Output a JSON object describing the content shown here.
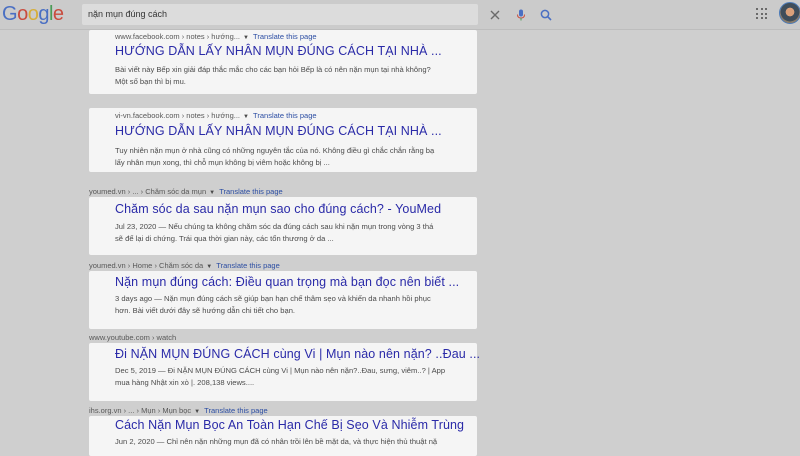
{
  "header": {
    "logo": [
      "G",
      "o",
      "o",
      "g",
      "l",
      "e"
    ],
    "logo_colors": [
      "#4a6fc3",
      "#c94c3e",
      "#d6ae3a",
      "#4a6fc3",
      "#4a9b56",
      "#c94c3e"
    ],
    "search_value": "nặn mụn đúng cách",
    "icons": [
      "close-icon",
      "mic-icon",
      "search-icon",
      "apps-grid-icon",
      "avatar"
    ]
  },
  "results": [
    {
      "source": "www.facebook.com › notes › hướng...",
      "translate": "Translate this page",
      "title": "HƯỚNG DẪN LẤY NHÂN MỤN ĐÚNG CÁCH TẠI NHÀ ...",
      "snippet": [
        "Bài viết này Bếp xin giải đáp thắc mắc cho các bạn hỏi Bếp là có nên nặn mụn tại nhà không?",
        "Một số bạn thì bị mu."
      ]
    },
    {
      "source": "vi-vn.facebook.com › notes › hướng...",
      "translate": "Translate this page",
      "title": "HƯỚNG DẪN LẤY NHÂN MỤN ĐÚNG CÁCH TẠI NHÀ ...",
      "snippet": [
        "Tuy nhiên nặn mụn ở nhà cũng có những nguyên tắc của nó. Không điều gì chắc chắn rằng bạ",
        "lấy nhân mụn xong, thì chỗ mụn không bị viêm hoặc không bị ..."
      ]
    },
    {
      "source": "youmed.vn › ... › Chăm sóc da mụn",
      "translate": "Translate this page",
      "title": "Chăm sóc da sau nặn mụn sao cho đúng cách? - YouMed",
      "snippet": [
        "Jul 23, 2020 — Nếu chúng ta không chăm sóc da đúng cách sau khi nặn mụn trong vòng 3 thá",
        "sẽ để lại di chứng. Trái qua thời gian này, các tổn thương ở da ..."
      ]
    },
    {
      "source": "youmed.vn › Home › Chăm sóc da",
      "translate": "Translate this page",
      "title": "Nặn mụn đúng cách: Điều quan trọng mà bạn đọc nên biết ...",
      "snippet": [
        "3 days ago — Nặn mụn đúng cách sẽ giúp bạn hạn chế thâm sẹo và khiến da nhanh hồi phục",
        "hơn. Bài viết dưới đây sẽ hướng dẫn chi tiết cho bạn."
      ]
    },
    {
      "source": "www.youtube.com › watch",
      "translate": "",
      "title": "Đi NẶN MỤN ĐÚNG CÁCH cùng Vi | Mụn nào nên nặn? ..Đau ...",
      "snippet": [
        "Dec 5, 2019 — Đi NẶN MỤN ĐÚNG CÁCH cùng Vi | Mụn nào nên nặn?..Đau, sưng, viêm..? | App",
        "mua hàng Nhật xin xò |. 208,138 views...."
      ]
    },
    {
      "source": "ihs.org.vn › ... › Mụn › Mụn bọc",
      "translate": "Translate this page",
      "title": "Cách Nặn Mụn Bọc An Toàn Hạn Chế Bị Sẹo Và Nhiễm Trùng",
      "snippet": [
        "Jun 2, 2020 — Chỉ nên nặn những mụn đã có nhân trồi lên bề mặt da, và thực hiện thủ thuật nặ"
      ]
    }
  ]
}
